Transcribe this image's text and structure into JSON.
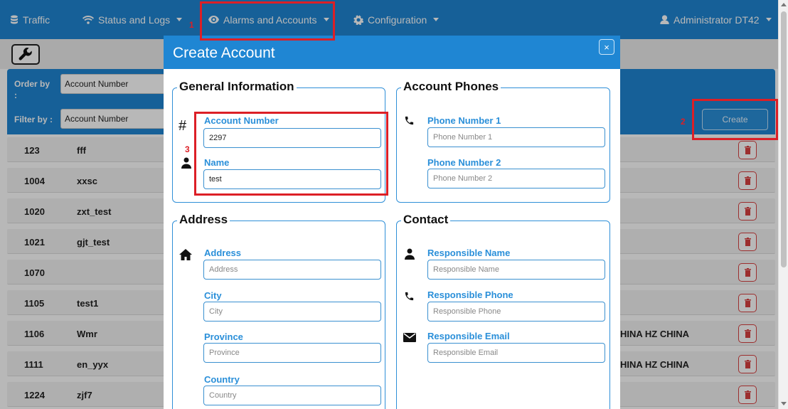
{
  "nav": {
    "traffic": "Traffic",
    "status_logs": "Status and Logs",
    "alarms_accounts": "Alarms and Accounts",
    "configuration": "Configuration",
    "user": "Administrator DT42"
  },
  "filters": {
    "order_by_label": "Order by",
    "order_by_colon": ":",
    "order_by_value": "Account Number",
    "filter_by_label": "Filter by :",
    "filter_by_value": "Account Number",
    "create_label": "Create"
  },
  "rows": [
    {
      "number": "123",
      "name": "fff",
      "extra": ""
    },
    {
      "number": "1004",
      "name": "xxsc",
      "extra": ""
    },
    {
      "number": "1020",
      "name": "zxt_test",
      "extra": ""
    },
    {
      "number": "1021",
      "name": "gjt_test",
      "extra": ""
    },
    {
      "number": "1070",
      "name": "",
      "extra": ""
    },
    {
      "number": "1105",
      "name": "test1",
      "extra": ""
    },
    {
      "number": "1106",
      "name": "Wmr",
      "extra": "HINA HZ CHINA"
    },
    {
      "number": "1111",
      "name": "en_yyx",
      "extra": "HINA HZ CHINA"
    },
    {
      "number": "1224",
      "name": "zjf7",
      "extra": ""
    }
  ],
  "modal": {
    "title": "Create Account",
    "close": "×",
    "general": {
      "legend": "General Information",
      "hash": "#",
      "account_number_label": "Account Number",
      "account_number_value": "2297",
      "name_label": "Name",
      "name_value": "test"
    },
    "phones": {
      "legend": "Account Phones",
      "phone1_label": "Phone Number 1",
      "phone1_placeholder": "Phone Number 1",
      "phone2_label": "Phone Number 2",
      "phone2_placeholder": "Phone Number 2"
    },
    "address": {
      "legend": "Address",
      "address_label": "Address",
      "address_placeholder": "Address",
      "city_label": "City",
      "city_placeholder": "City",
      "province_label": "Province",
      "province_placeholder": "Province",
      "country_label": "Country",
      "country_placeholder": "Country"
    },
    "contact": {
      "legend": "Contact",
      "resp_name_label": "Responsible Name",
      "resp_name_placeholder": "Responsible Name",
      "resp_phone_label": "Responsible Phone",
      "resp_phone_placeholder": "Responsible Phone",
      "resp_email_label": "Responsible Email",
      "resp_email_placeholder": "Responsible Email"
    }
  },
  "annotations": {
    "one": "1",
    "two": "2",
    "three": "3"
  },
  "colors": {
    "primary": "#1f86d3",
    "annotation_red": "#dc1f26",
    "delete_red": "#d84040"
  },
  "icons": [
    "database-icon",
    "wifi-icon",
    "eye-icon",
    "gear-icon",
    "user-icon",
    "wrench-icon",
    "trash-icon",
    "phone-icon",
    "person-icon",
    "home-icon",
    "envelope-icon",
    "close-icon"
  ]
}
